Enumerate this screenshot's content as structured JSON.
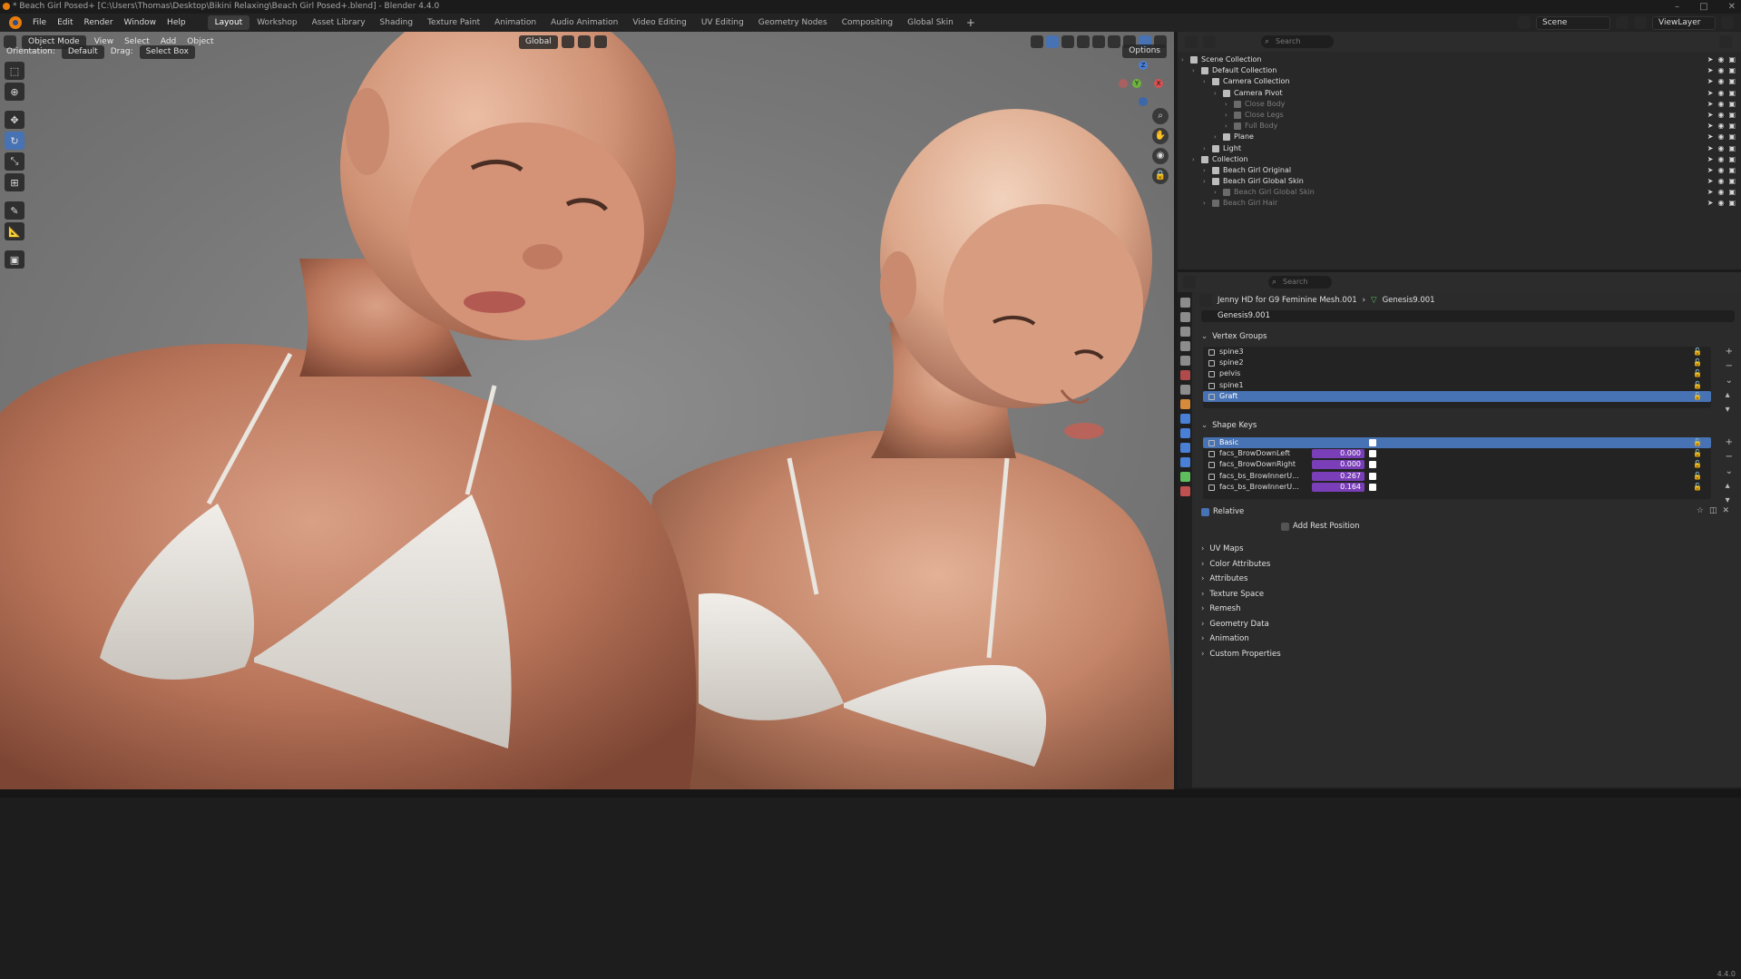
{
  "window": {
    "title": "* Beach Girl Posed+ [C:\\Users\\Thomas\\Desktop\\Bikini Relaxing\\Beach Girl Posed+.blend] - Blender 4.4.0",
    "controls": [
      "–",
      "□",
      "✕"
    ]
  },
  "menu": [
    "File",
    "Edit",
    "Render",
    "Window",
    "Help"
  ],
  "workspaces": [
    "Layout",
    "Workshop",
    "Asset Library",
    "Shading",
    "Texture Paint",
    "Animation",
    "Audio Animation",
    "Video Editing",
    "UV Editing",
    "Geometry Nodes",
    "Compositing",
    "Global Skin"
  ],
  "active_workspace": "Layout",
  "scene": {
    "scene_name": "Scene",
    "view_layer": "ViewLayer"
  },
  "viewport": {
    "mode": "Object Mode",
    "menus": [
      "View",
      "Select",
      "Add",
      "Object"
    ],
    "orientation_label": "Orientation:",
    "orientation_value": "Default",
    "drag_label": "Drag:",
    "drag_value": "Select Box",
    "transform": "Global",
    "options": "Options",
    "gizmo": {
      "z": "Z",
      "y": "Y",
      "x": "X"
    }
  },
  "outliner": {
    "search_placeholder": "Search",
    "rows": [
      {
        "label": "Scene Collection",
        "depth": 0,
        "dim": false,
        "color": "#e0e0e0"
      },
      {
        "label": "Default Collection",
        "depth": 1,
        "dim": false,
        "color": "#e0e0e0"
      },
      {
        "label": "Camera Collection",
        "depth": 2,
        "dim": false,
        "color": "#e0e0e0"
      },
      {
        "label": "Camera Pivot",
        "depth": 3,
        "dim": false,
        "color": "#e0e0e0"
      },
      {
        "label": "Close Body",
        "depth": 4,
        "dim": true,
        "color": "#7d7d7d"
      },
      {
        "label": "Close Legs",
        "depth": 4,
        "dim": true,
        "color": "#7d7d7d"
      },
      {
        "label": "Full Body",
        "depth": 4,
        "dim": true,
        "color": "#7d7d7d"
      },
      {
        "label": "Plane",
        "depth": 3,
        "dim": false,
        "color": "#e0e0e0"
      },
      {
        "label": "Light",
        "depth": 2,
        "dim": false,
        "color": "#e0e0e0"
      },
      {
        "label": "Collection",
        "depth": 1,
        "dim": false,
        "color": "#e0e0e0"
      },
      {
        "label": "Beach Girl Original",
        "depth": 2,
        "dim": false,
        "color": "#e0e0e0"
      },
      {
        "label": "Beach Girl Global Skin",
        "depth": 2,
        "dim": false,
        "color": "#e0e0e0"
      },
      {
        "label": "Beach Girl Global Skin",
        "depth": 3,
        "dim": true,
        "color": "#7d7d7d"
      },
      {
        "label": "Beach Girl Hair",
        "depth": 2,
        "dim": true,
        "color": "#7d7d7d"
      }
    ]
  },
  "properties": {
    "search_placeholder": "Search",
    "object_name": "Jenny HD for G9 Feminine Mesh.001",
    "mesh_name": "Genesis9.001",
    "mesh_field": "Genesis9.001",
    "vertex_groups_title": "Vertex Groups",
    "vertex_groups": [
      "spine3",
      "spine2",
      "pelvis",
      "spine1",
      "Graft"
    ],
    "shape_keys_title": "Shape Keys",
    "shape_keys": [
      {
        "name": "Basic",
        "value": ""
      },
      {
        "name": "facs_BrowDownLeft",
        "value": "0.000"
      },
      {
        "name": "facs_BrowDownRight",
        "value": "0.000"
      },
      {
        "name": "facs_bs_BrowInnerU...",
        "value": "0.267"
      },
      {
        "name": "facs_bs_BrowInnerU...",
        "value": "0.164"
      }
    ],
    "relative_label": "Relative",
    "add_rest_label": "Add Rest Position",
    "closed_panels": [
      "UV Maps",
      "Color Attributes",
      "Attributes",
      "Texture Space",
      "Remesh",
      "Geometry Data",
      "Animation",
      "Custom Properties"
    ]
  },
  "version": "4.4.0",
  "colors": {
    "accent": "#4772b3",
    "shape_key_value": "#7a3fb8",
    "skin": "#c98a6f",
    "bikini": "#e9e5df"
  }
}
